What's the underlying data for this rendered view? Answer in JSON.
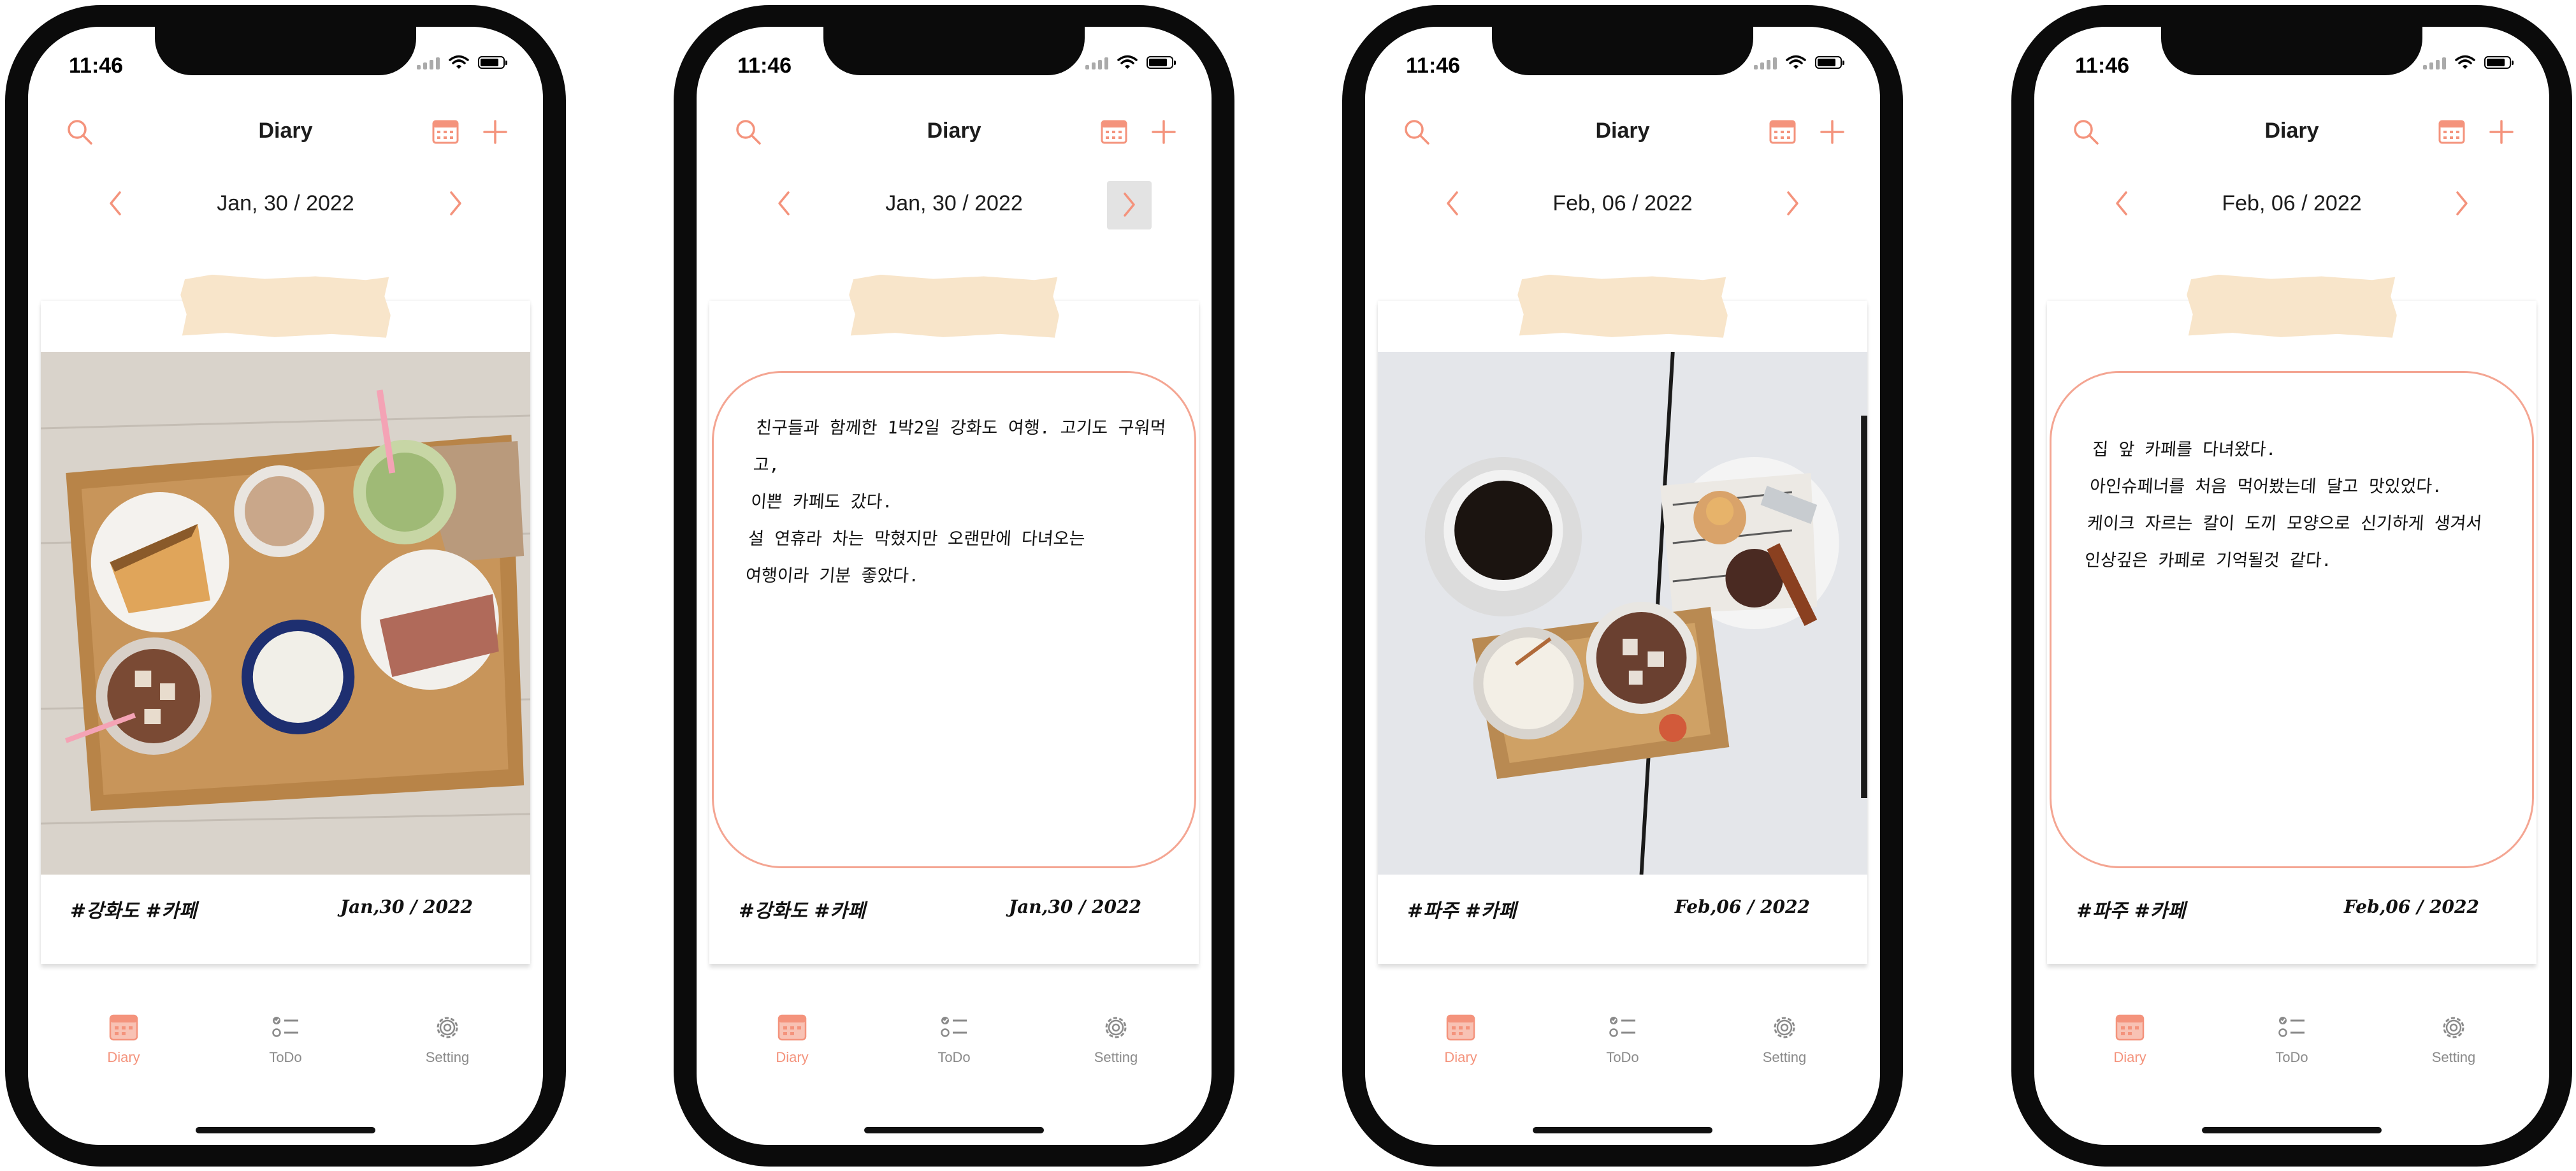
{
  "colors": {
    "accent": "#f4937c",
    "tape": "#f8e5ca",
    "text_box_border": "#f4a592"
  },
  "screens": [
    {
      "status_time": "11:46",
      "nav_title": "Diary",
      "date": "Jan, 30 / 2022",
      "content_type": "photo",
      "diary_text": "",
      "tags": "#강화도 #카페",
      "footer_date": "Jan,30 / 2022",
      "tabs": [
        "Diary",
        "ToDo",
        "Setting"
      ]
    },
    {
      "status_time": "11:46",
      "nav_title": "Diary",
      "date": "Jan, 30 / 2022",
      "content_type": "text",
      "diary_text": "친구들과 함께한 1박2일 강화도 여행. 고기도 구워먹고,\n이쁜 카페도 갔다.\n설 연휴라 차는 막혔지만 오랜만에 다녀오는\n여행이라 기분 좋았다.",
      "tags": "#강화도 #카페",
      "footer_date": "Jan,30 / 2022",
      "tabs": [
        "Diary",
        "ToDo",
        "Setting"
      ]
    },
    {
      "status_time": "11:46",
      "nav_title": "Diary",
      "date": "Feb, 06 / 2022",
      "content_type": "photo",
      "diary_text": "",
      "tags": "#파주 #카페",
      "footer_date": "Feb,06 / 2022",
      "tabs": [
        "Diary",
        "ToDo",
        "Setting"
      ]
    },
    {
      "status_time": "11:46",
      "nav_title": "Diary",
      "date": "Feb, 06 / 2022",
      "content_type": "text",
      "diary_text": "집 앞 카페를 다녀왔다.\n아인슈페너를 처음 먹어봤는데 달고 맛있었다.\n케이크 자르는 칼이 도끼 모양으로 신기하게 생겨서\n인상깊은 카페로 기억될것 같다.",
      "tags": "#파주 #카페",
      "footer_date": "Feb,06 / 2022",
      "tabs": [
        "Diary",
        "ToDo",
        "Setting"
      ]
    }
  ]
}
